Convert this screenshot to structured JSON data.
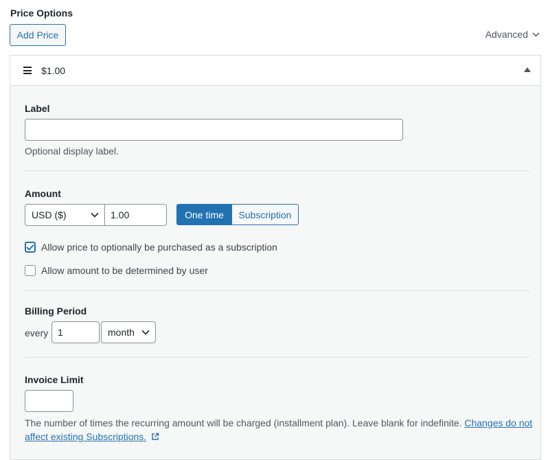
{
  "header": {
    "title": "Price Options",
    "add_price_label": "Add Price",
    "advanced_label": "Advanced"
  },
  "price_panel": {
    "title": "$1.00",
    "label": {
      "label": "Label",
      "value": "",
      "placeholder": "",
      "help": "Optional display label."
    },
    "amount": {
      "label": "Amount",
      "currency_value": "USD ($)",
      "amount_value": "1.00",
      "type_options": [
        "One time",
        "Subscription"
      ],
      "type_selected": "One time",
      "checkboxes": [
        {
          "label": "Allow price to optionally be purchased as a subscription",
          "checked": true
        },
        {
          "label": "Allow amount to be determined by user",
          "checked": false
        }
      ]
    },
    "billing": {
      "label": "Billing Period",
      "every_label": "every",
      "interval_value": "1",
      "unit_value": "month"
    },
    "invoice": {
      "label": "Invoice Limit",
      "value": "",
      "help_text": "The number of times the recurring amount will be charged (installment plan). Leave blank for indefinite. ",
      "help_link_line1": "Changes do not",
      "help_link_line2": "affect existing Subscriptions."
    }
  },
  "colors": {
    "accent": "#2271b1",
    "border": "#dcdcde",
    "panel_bg": "#f6f7f7",
    "text": "#1d2327",
    "muted": "#50575e"
  },
  "icons": {
    "advanced_chevron": "chevron-down-icon",
    "drag": "drag-handle-icon",
    "collapse": "triangle-up-icon",
    "external": "external-link-icon"
  }
}
